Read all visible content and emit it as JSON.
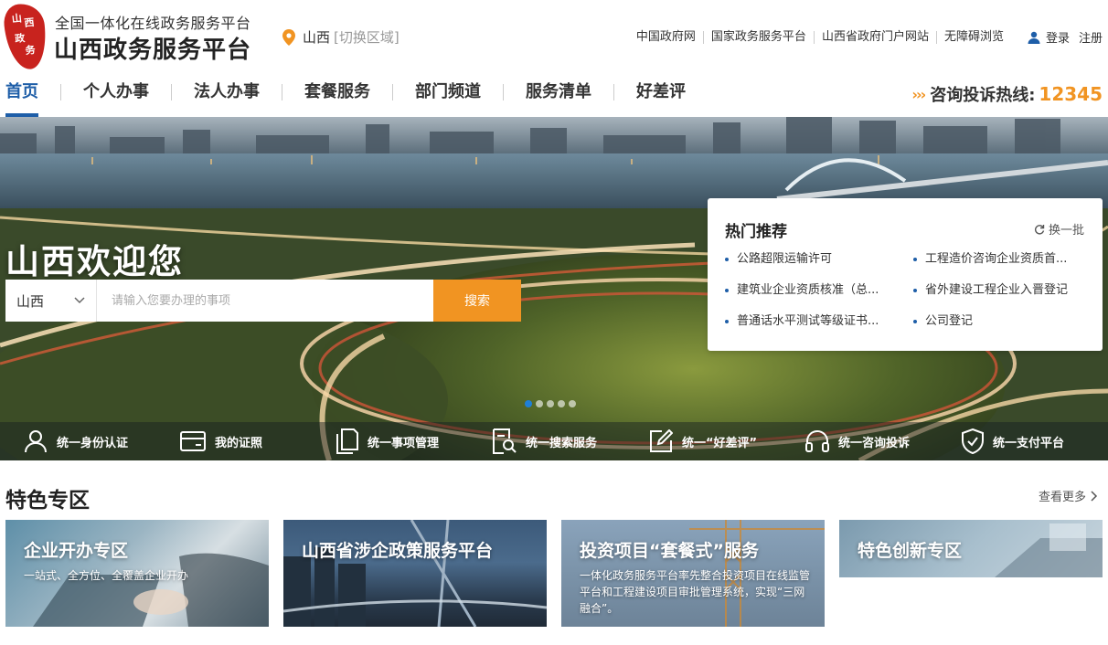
{
  "header": {
    "logo_text": "山西政务",
    "subtitle": "全国一体化在线政务服务平台",
    "title": "山西政务服务平台",
    "location": {
      "region": "山西",
      "switch": "[切换区域]"
    },
    "links": [
      "中国政府网",
      "国家政务服务平台",
      "山西省政府门户网站",
      "无障碍浏览"
    ],
    "login": "登录",
    "register": "注册"
  },
  "nav": {
    "items": [
      "首页",
      "个人办事",
      "法人办事",
      "套餐服务",
      "部门频道",
      "服务清单",
      "好差评"
    ],
    "hotline_label": "咨询投诉热线:",
    "hotline_number": "12345"
  },
  "banner": {
    "welcome": "山西欢迎您",
    "search": {
      "region": "山西",
      "placeholder": "请输入您要办理的事项",
      "button": "搜索"
    },
    "slides": {
      "count": 5,
      "active": 1
    },
    "hot": {
      "title": "热门推荐",
      "refresh": "换一批",
      "items": [
        "公路超限运输许可",
        "工程造价咨询企业资质首...",
        "建筑业企业资质核准（总...",
        "省外建设工程企业入晋登记",
        "普通话水平测试等级证书...",
        "公司登记"
      ]
    },
    "services": [
      {
        "label": "统一身份认证",
        "icon": "user-icon"
      },
      {
        "label": "我的证照",
        "icon": "card-icon"
      },
      {
        "label": "统一事项管理",
        "icon": "document-icon"
      },
      {
        "label": "统一搜索服务",
        "icon": "search-doc-icon"
      },
      {
        "label": "统一“好差评”",
        "icon": "edit-icon"
      },
      {
        "label": "统一咨询投诉",
        "icon": "headset-icon"
      },
      {
        "label": "统一支付平台",
        "icon": "shield-check-icon"
      }
    ]
  },
  "featured": {
    "title": "特色专区",
    "more": "查看更多",
    "cards": [
      {
        "title": "企业开办专区",
        "desc": "一站式、全方位、全覆盖企业开办"
      },
      {
        "title": "山西省涉企政策服务平台",
        "desc": ""
      },
      {
        "title": "投资项目“套餐式”服务",
        "desc": "一体化政务服务平台率先整合投资项目在线监管平台和工程建设项目审批管理系统，实现“三网融合”。"
      },
      {
        "title": "特色创新专区",
        "desc": ""
      }
    ]
  },
  "colors": {
    "primary": "#1e5ea8",
    "accent": "#f19422",
    "logo_red": "#c8231e"
  }
}
